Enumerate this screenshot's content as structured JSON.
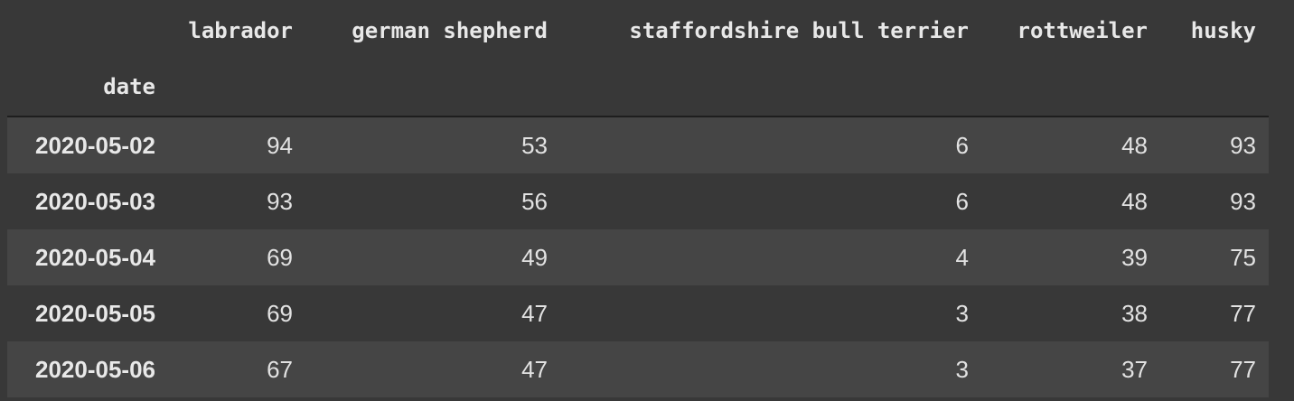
{
  "table": {
    "columns": [
      "labrador",
      "german shepherd",
      "staffordshire bull terrier",
      "rottweiler",
      "husky"
    ],
    "index_name": "date",
    "rows": [
      {
        "index": "2020-05-02",
        "values": [
          "94",
          "53",
          "6",
          "48",
          "93"
        ]
      },
      {
        "index": "2020-05-03",
        "values": [
          "93",
          "56",
          "6",
          "48",
          "93"
        ]
      },
      {
        "index": "2020-05-04",
        "values": [
          "69",
          "49",
          "4",
          "39",
          "75"
        ]
      },
      {
        "index": "2020-05-05",
        "values": [
          "69",
          "47",
          "3",
          "38",
          "77"
        ]
      },
      {
        "index": "2020-05-06",
        "values": [
          "67",
          "47",
          "3",
          "37",
          "77"
        ]
      }
    ]
  },
  "colors": {
    "background": "#383838",
    "row_alt": "#454545",
    "text": "#e6e6e6"
  }
}
